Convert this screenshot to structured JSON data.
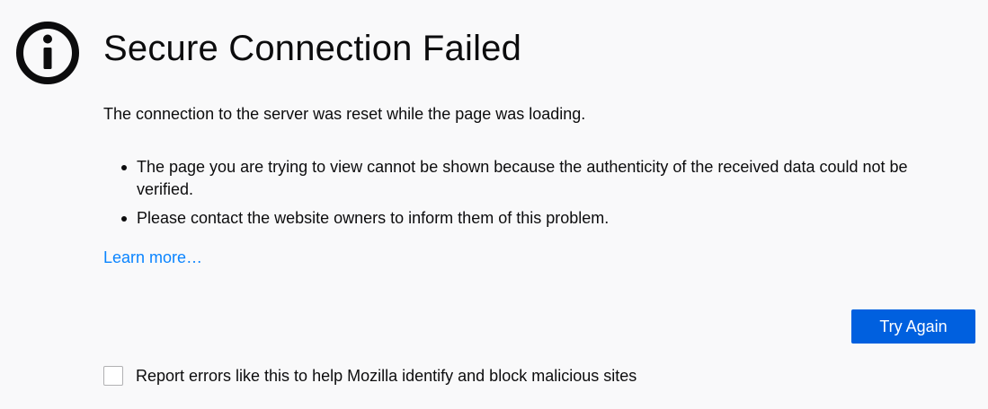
{
  "error": {
    "icon": "info-icon",
    "title": "Secure Connection Failed",
    "short_description": "The connection to the server was reset while the page was loading.",
    "details": [
      "The page you are trying to view cannot be shown because the authenticity of the received data could not be verified.",
      "Please contact the website owners to inform them of this problem."
    ],
    "learn_more": "Learn more…"
  },
  "actions": {
    "try_again_label": "Try Again"
  },
  "report": {
    "checked": false,
    "label": "Report errors like this to help Mozilla identify and block malicious sites"
  },
  "colors": {
    "background": "#f9f9fa",
    "link": "#0a84ff",
    "primary_button": "#0060df",
    "text": "#0c0c0d"
  }
}
